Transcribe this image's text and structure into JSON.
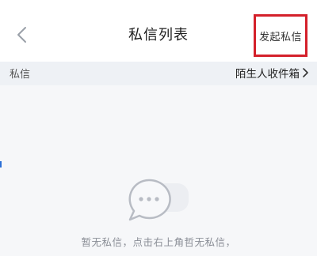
{
  "nav": {
    "back_icon": "chevron-left-icon",
    "title": "私信列表",
    "action_label": "发起私信",
    "highlight_color": "#d4202a"
  },
  "sub_header": {
    "label": "私信",
    "stranger_inbox_label": "陌生人收件箱",
    "chevron_icon": "chevron-right-icon"
  },
  "empty_state": {
    "icon": "chat-bubble-icon",
    "message": "暂无私信，点击右上角哲无私信，"
  }
}
